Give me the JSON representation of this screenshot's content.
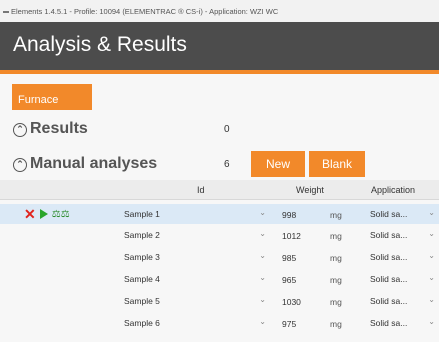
{
  "window": {
    "title": "Elements 1.4.5.1 - Profile: 10094 (ELEMENTRAC ® CS-i) - Application: WZI WC"
  },
  "header": {
    "title": "Analysis & Results"
  },
  "toolbar": {
    "furnace_label": "Furnace"
  },
  "results": {
    "label": "Results",
    "count": "0"
  },
  "manual": {
    "label": "Manual analyses",
    "count": "6",
    "new_label": "New",
    "blank_label": "Blank"
  },
  "table": {
    "columns": {
      "id": "Id",
      "weight": "Weight",
      "application": "Application"
    },
    "rows": [
      {
        "id": "Sample 1",
        "weight": "998",
        "unit": "mg",
        "application": "Solid sa..."
      },
      {
        "id": "Sample 2",
        "weight": "1012",
        "unit": "mg",
        "application": "Solid sa..."
      },
      {
        "id": "Sample 3",
        "weight": "985",
        "unit": "mg",
        "application": "Solid sa..."
      },
      {
        "id": "Sample 4",
        "weight": "965",
        "unit": "mg",
        "application": "Solid sa..."
      },
      {
        "id": "Sample 5",
        "weight": "1030",
        "unit": "mg",
        "application": "Solid sa..."
      },
      {
        "id": "Sample 6",
        "weight": "975",
        "unit": "mg",
        "application": "Solid sa..."
      }
    ]
  },
  "icons": {
    "delete": "x-icon",
    "start": "play-icon",
    "weigh": "balance-icon",
    "collapse": "chevron-up-icon"
  },
  "colors": {
    "accent": "#f2892a",
    "header": "#4c4c4c",
    "selected_row": "#dbe9f6"
  }
}
